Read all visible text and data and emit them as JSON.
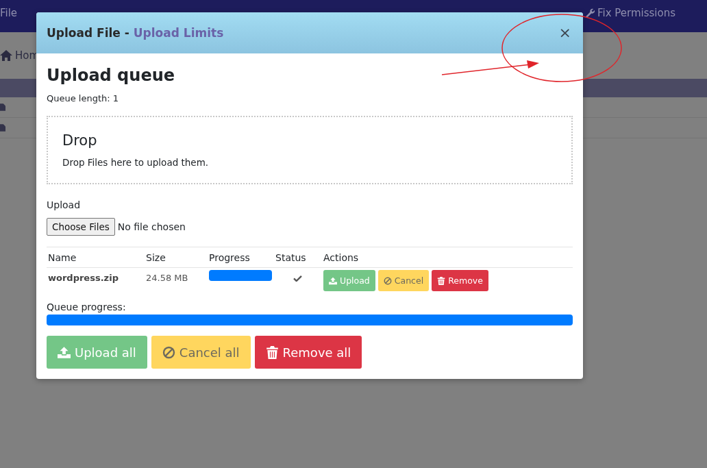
{
  "toolbar": {
    "items": [
      {
        "label": "File"
      },
      {
        "label": "Fix Permissions"
      }
    ]
  },
  "breadcrumb": {
    "label": "Hom"
  },
  "dialog": {
    "title": "Upload File -",
    "title_link": "Upload Limits",
    "close": "×",
    "heading": "Upload queue",
    "queue_length": "Queue length: 1",
    "drop": {
      "title": "Drop",
      "text": "Drop Files here to upload them."
    },
    "upload_label": "Upload",
    "file_input": {
      "button": "Choose Files",
      "value": "No file chosen"
    },
    "table": {
      "columns": [
        "Name",
        "Size",
        "Progress",
        "Status",
        "Actions"
      ],
      "rows": [
        {
          "name": "wordpress.zip",
          "size": "24.58 MB",
          "level": 1,
          "done": true,
          "actions": [
            {
              "kind": "upload",
              "label": "Upload"
            },
            {
              "kind": "cancel",
              "label": "Cancel"
            },
            {
              "kind": "remove",
              "label": "Remove"
            }
          ]
        }
      ]
    },
    "queue_progress": {
      "label": "Queue progress:",
      "level": 1
    },
    "buttons": [
      {
        "kind": "upload",
        "label": "Upload all"
      },
      {
        "kind": "cancel",
        "label": "Cancel all"
      },
      {
        "kind": "remove",
        "label": "Remove all"
      }
    ]
  }
}
